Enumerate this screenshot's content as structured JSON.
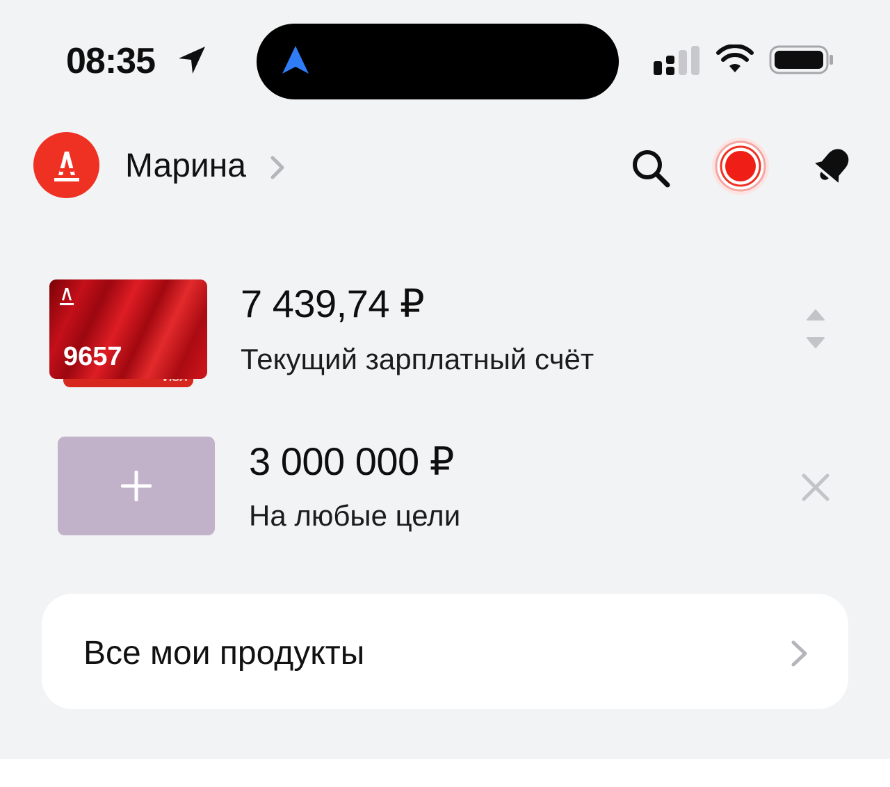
{
  "status_bar": {
    "time": "08:35",
    "location_icon": "location-arrow-icon",
    "island_icon": "navigation-arrow-icon",
    "signal_icon": "cellular-signal-icon",
    "wifi_icon": "wifi-icon",
    "battery_icon": "battery-icon"
  },
  "header": {
    "logo_letter": "А",
    "user_name": "Марина",
    "icons": [
      "search-icon",
      "record-icon",
      "bell-icon"
    ]
  },
  "products": [
    {
      "card_last_digits": "9657",
      "card_logo_letter": "А",
      "card_network": "VISA",
      "amount": "7 439,74 ₽",
      "title": "Текущий зарплатный счёт"
    },
    {
      "amount": "3 000 000 ₽",
      "title": "На любые цели"
    }
  ],
  "all_products": {
    "label": "Все мои продукты"
  },
  "colors": {
    "brand_red": "#ef3124",
    "background": "#f2f3f5",
    "goal_tile": "#c1b2ca",
    "nav_blue": "#2f7cf6"
  }
}
